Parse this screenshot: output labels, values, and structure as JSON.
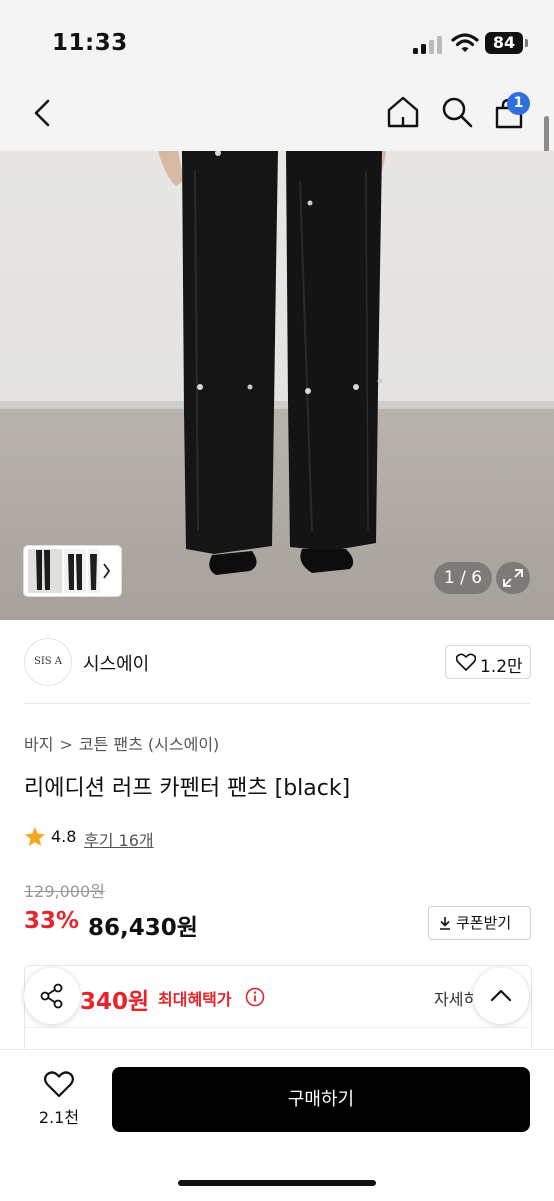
{
  "status_bar": {
    "time": "11:33",
    "battery": "84"
  },
  "nav": {
    "cart_badge": "1"
  },
  "gallery": {
    "counter": "1 / 6"
  },
  "brand": {
    "logo_text": "SIS A",
    "name": "시스에이",
    "likes": "1.2만"
  },
  "breadcrumb": {
    "category": "바지",
    "separator": ">",
    "subcategory": "코튼 팬츠 (시스에이)"
  },
  "product": {
    "title": "리에디션 러프 카펜터 팬츠 [black]",
    "rating": "4.8",
    "review_link": "후기 16개",
    "original_price": "129,000원",
    "discount": "33%",
    "sale_price": "86,430원",
    "coupon_button": "쿠폰받기"
  },
  "benefit": {
    "price": "340원",
    "label": "최대혜택가",
    "detail_link": "자세히"
  },
  "bottom": {
    "wish_count": "2.1천",
    "buy_label": "구매하기"
  },
  "colors": {
    "accent_red": "#e5242b",
    "badge_blue": "#2f6fde",
    "star": "#f5a623"
  }
}
